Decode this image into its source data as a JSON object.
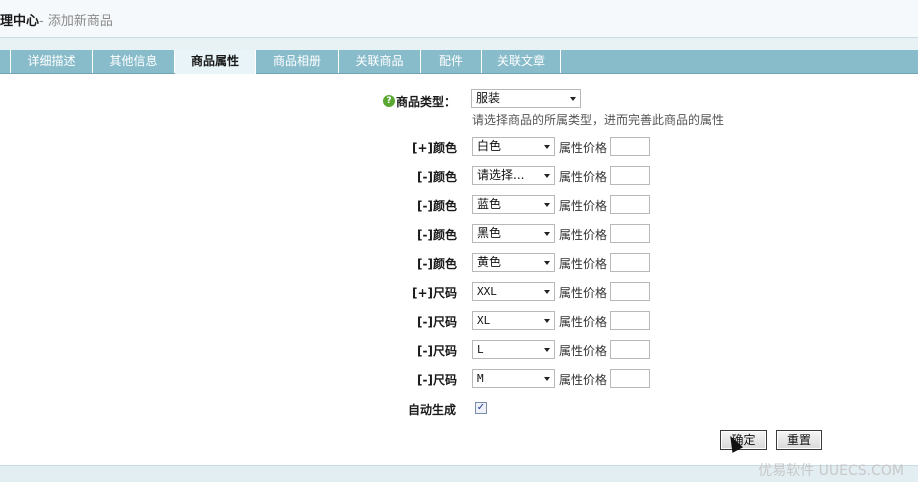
{
  "header": {
    "title": "管理中心",
    "title_visible": "理中心",
    "subtitle": "- 添加新商品"
  },
  "tabs": [
    {
      "label": "",
      "active": false
    },
    {
      "label": "详细描述",
      "active": false
    },
    {
      "label": "其他信息",
      "active": false
    },
    {
      "label": "商品属性",
      "active": true
    },
    {
      "label": "商品相册",
      "active": false
    },
    {
      "label": "关联商品",
      "active": false
    },
    {
      "label": "配件",
      "active": false
    },
    {
      "label": "关联文章",
      "active": false
    }
  ],
  "form": {
    "type_label": "商品类型：",
    "type_value": "服装",
    "type_hint": "请选择商品的所属类型，进而完善此商品的属性",
    "price_label": "属性价格",
    "rows": [
      {
        "label": "[+]颜色",
        "value": "白色",
        "mono": false
      },
      {
        "label": "[-]颜色",
        "value": "请选择...",
        "mono": false
      },
      {
        "label": "[-]颜色",
        "value": "蓝色",
        "mono": false
      },
      {
        "label": "[-]颜色",
        "value": "黑色",
        "mono": false
      },
      {
        "label": "[-]颜色",
        "value": "黄色",
        "mono": false
      },
      {
        "label": "[+]尺码",
        "value": "XXL",
        "mono": true
      },
      {
        "label": "[-]尺码",
        "value": "XL",
        "mono": true
      },
      {
        "label": "[-]尺码",
        "value": "L",
        "mono": true
      },
      {
        "label": "[-]尺码",
        "value": "M",
        "mono": true
      }
    ],
    "auto_generate_label": "自动生成",
    "auto_generate_checked": true,
    "confirm_label": "确定",
    "reset_label": "重置"
  },
  "icons": {
    "help": "help-icon",
    "dropdown": "chevron-down-icon",
    "cursor": "mouse-cursor-icon"
  },
  "watermark": "优易软件 UUECS.COM",
  "colors": {
    "tabbar": "#88bccb",
    "tab_active_bg": "#e8f4f7",
    "help_icon": "#5aa832"
  }
}
